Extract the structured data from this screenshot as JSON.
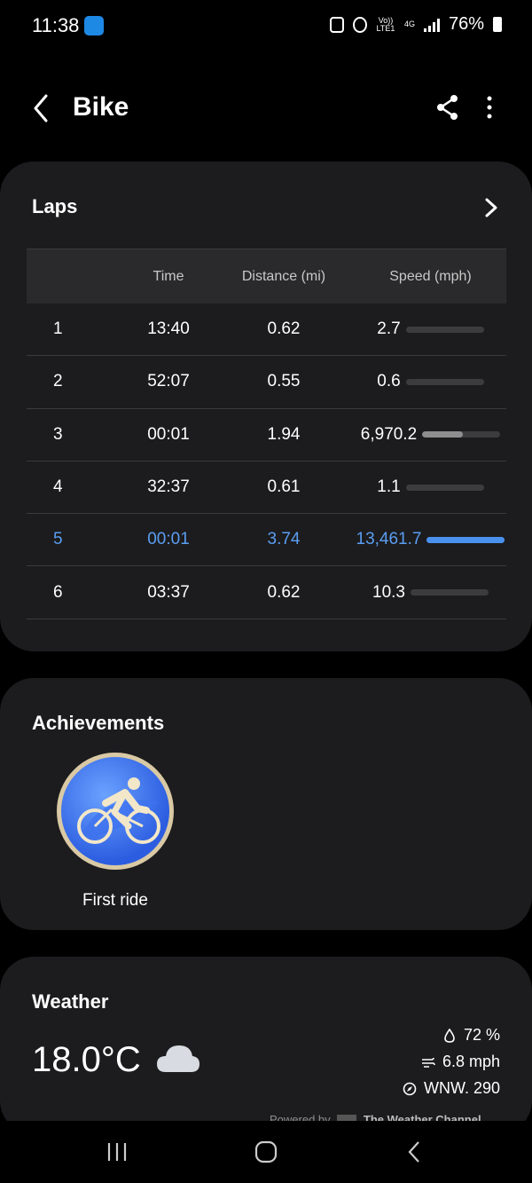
{
  "status_bar": {
    "time": "11:38",
    "battery": "76%",
    "network": "4G",
    "volte": "Vo)) LTE1"
  },
  "header": {
    "title": "Bike",
    "back_icon": "back-icon",
    "share_icon": "share-icon",
    "more_icon": "more-vertical-icon"
  },
  "laps": {
    "title": "Laps",
    "columns": [
      "",
      "Time",
      "Distance (mi)",
      "Speed (mph)"
    ],
    "rows": [
      {
        "lap": "1",
        "time": "13:40",
        "distance": "0.62",
        "speed": "2.7",
        "fraction": 0.0002
      },
      {
        "lap": "2",
        "time": "52:07",
        "distance": "0.55",
        "speed": "0.6",
        "fraction": 5e-05
      },
      {
        "lap": "3",
        "time": "00:01",
        "distance": "1.94",
        "speed": "6,970.2",
        "fraction": 0.52
      },
      {
        "lap": "4",
        "time": "32:37",
        "distance": "0.61",
        "speed": "1.1",
        "fraction": 0.0001
      },
      {
        "lap": "5",
        "time": "00:01",
        "distance": "3.74",
        "speed": "13,461.7",
        "fraction": 1.0,
        "highlight": true
      },
      {
        "lap": "6",
        "time": "03:37",
        "distance": "0.62",
        "speed": "10.3",
        "fraction": 0.0008
      }
    ]
  },
  "achievements": {
    "title": "Achievements",
    "badge_label": "First ride",
    "badge_icon": "cyclist-badge-icon"
  },
  "weather": {
    "title": "Weather",
    "temperature": "18.0°C",
    "condition_icon": "cloud-icon",
    "humidity": "72 %",
    "wind": "6.8 mph",
    "direction": "WNW. 290",
    "powered_by": "Powered by",
    "provider": "The Weather Channel"
  },
  "colors": {
    "accent": "#4a90ee",
    "card": "#1c1c1e",
    "background": "#000000"
  }
}
